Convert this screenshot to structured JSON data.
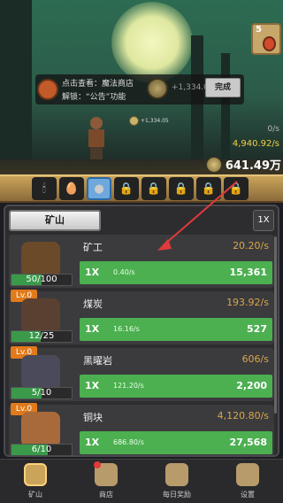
{
  "top_right_card": {
    "level": "5"
  },
  "quest": {
    "line1": "点击查看：魔法商店",
    "line2": "解锁：“公告”功能",
    "gain": "+1,334.05",
    "done_label": "完成"
  },
  "fly_text": "+1,334.05",
  "rates": {
    "rate1": "0/s",
    "rate2": "4,940.92/s"
  },
  "money": "641.49万",
  "slots": [
    "candle",
    "egg",
    "slime",
    "lock",
    "lock",
    "lock",
    "lock",
    "lock"
  ],
  "panel": {
    "tab_label": "矿山",
    "multiplier": "1X"
  },
  "rows": [
    {
      "level": "",
      "name": "矿工",
      "rate": "20.20/s",
      "count": "50/100",
      "progress": 0.5,
      "mult": "1X",
      "speed": "0.40/s",
      "cost": "15,361",
      "color": "#6b4a2a"
    },
    {
      "level": "Lv.0",
      "name": "煤炭",
      "rate": "193.92/s",
      "count": "12/25",
      "progress": 0.48,
      "mult": "1X",
      "speed": "16.16/s",
      "cost": "527",
      "color": "#5a4030"
    },
    {
      "level": "Lv.0",
      "name": "黑曜岩",
      "rate": "606/s",
      "count": "5/10",
      "progress": 0.5,
      "mult": "1X",
      "speed": "121.20/s",
      "cost": "2,200",
      "color": "#4a4a5a"
    },
    {
      "level": "Lv.0",
      "name": "铜块",
      "rate": "4,120.80/s",
      "count": "6/10",
      "progress": 0.6,
      "mult": "1X",
      "speed": "686.80/s",
      "cost": "27,568",
      "color": "#a86a3a"
    }
  ],
  "nav": [
    {
      "label": "矿山",
      "active": true,
      "badge": false
    },
    {
      "label": "商店",
      "active": false,
      "badge": true
    },
    {
      "label": "每日奖励",
      "active": false,
      "badge": false
    },
    {
      "label": "设置",
      "active": false,
      "badge": false
    }
  ],
  "colors": {
    "accent_green": "#4caf50",
    "rate_orange": "#d8a64a",
    "level_orange": "#e07a1a",
    "arrow_red": "#e03a3a"
  }
}
